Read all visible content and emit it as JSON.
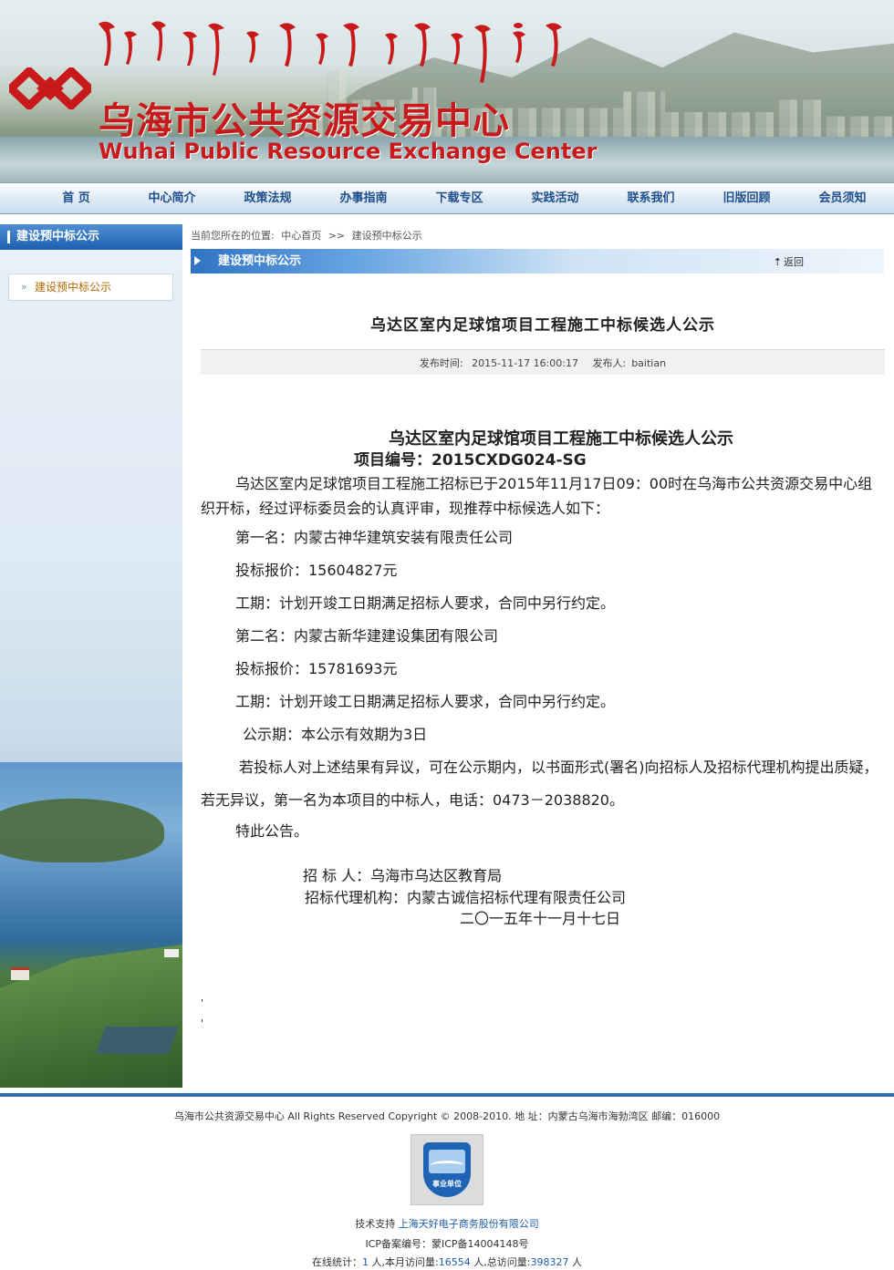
{
  "header": {
    "title_cn": "乌海市公共资源交易中心",
    "title_en": "Wuhai Public Resource Exchange Center"
  },
  "nav": {
    "items": [
      "首 页",
      "中心简介",
      "政策法规",
      "办事指南",
      "下载专区",
      "实践活动",
      "联系我们",
      "旧版回顾",
      "会员须知"
    ]
  },
  "sidebar": {
    "title": "建设预中标公示",
    "items": [
      "建设预中标公示"
    ]
  },
  "breadcrumb": {
    "prefix": "当前您所在的位置:",
    "home": "中心首页",
    "sep": ">>",
    "current": "建设预中标公示"
  },
  "section": {
    "title": "建设预中标公示",
    "back_label": "返回"
  },
  "article": {
    "title": "乌达区室内足球馆项目工程施工中标候选人公示",
    "publish_label": "发布时间:",
    "publish_time": "2015-11-17 16:00:17",
    "author_label": "发布人:",
    "author": "baitian",
    "doc_title": "乌达区室内足球馆项目工程施工中标候选人公示",
    "doc_number": "项目编号：2015CXDG024-SG",
    "intro": "乌达区室内足球馆项目工程施工招标已于2015年11月17日09：00时在乌海市公共资源交易中心组织开标，经过评标委员会的认真评审，现推荐中标候选人如下：",
    "first_place": "第一名：内蒙古神华建筑安装有限责任公司",
    "first_price": "投标报价：15604827元",
    "first_period": "工期：计划开竣工日期满足招标人要求，合同中另行约定。",
    "second_place": "第二名：内蒙古新华建建设集团有限公司",
    "second_price": "投标报价：15781693元",
    "second_period": "工期：计划开竣工日期满足招标人要求，合同中另行约定。",
    "notice_period": "公示期：本公示有效期为3日",
    "objection": "若投标人对上述结果有异议，可在公示期内，以书面形式(署名)向招标人及招标代理机构提出质疑，若无异议，第一名为本项目的中标人，电话：0473－2038820。",
    "closing": "特此公告。",
    "tenderer": "招 标 人：乌海市乌达区教育局",
    "agency": "招标代理机构：内蒙古诚信招标代理有限责任公司",
    "date": "二〇一五年十一月十七日",
    "dot1": "'",
    "dot2": "'"
  },
  "footer": {
    "copyright": "乌海市公共资源交易中心  All Rights Reserved Copyright © 2008-2010. 地  址：内蒙古乌海市海勃湾区  邮编：016000",
    "badge_text": "事业单位",
    "support_label": "技术支持",
    "support_company": "上海天好电子商务股份有限公司",
    "icp": "ICP备案编号：蒙ICP备14004148号",
    "stats_online_label": "在线统计：",
    "stats_online": "1",
    "stats_online_unit": "人,本月访问量:",
    "stats_month": "16554",
    "stats_month_unit": "人,总访问量:",
    "stats_total": "398327",
    "stats_total_unit": "人"
  },
  "colors": {
    "brand_red": "#c8191b",
    "nav_blue": "#1e4e8c",
    "accent_blue": "#2e6db4"
  }
}
